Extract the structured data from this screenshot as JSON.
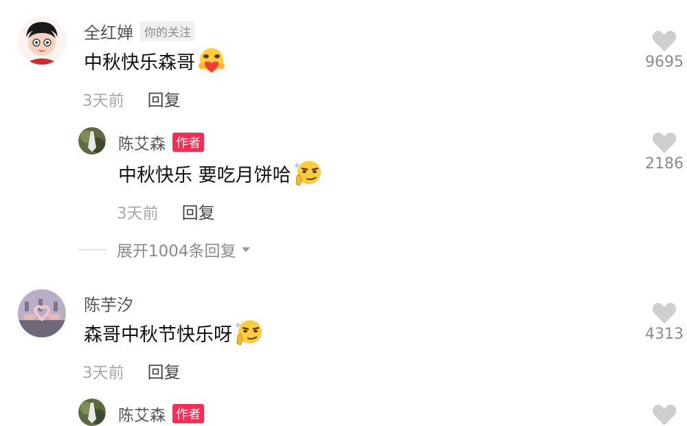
{
  "comments": [
    {
      "user": "全红婵",
      "badge": "你的关注",
      "text": "中秋快乐森哥",
      "emoji": "hugging-heart-face",
      "time": "3天前",
      "reply_label": "回复",
      "likes": "9695",
      "reply": {
        "user": "陈艾森",
        "badge": "作者",
        "text": "中秋快乐 要吃月饼哈",
        "emoji": "smirk-face",
        "time": "3天前",
        "reply_label": "回复",
        "likes": "2186"
      },
      "expand_label": "展开1004条回复"
    },
    {
      "user": "陈芋汐",
      "text": "森哥中秋节快乐呀",
      "emoji": "smirk-face",
      "time": "3天前",
      "reply_label": "回复",
      "likes": "4313",
      "reply": {
        "user": "陈艾森",
        "badge": "作者"
      }
    }
  ],
  "colors": {
    "author_tag": "#fc2b55",
    "heart": "#cfcfcf"
  },
  "icons": [
    "heart-icon",
    "chevron-down-icon"
  ]
}
